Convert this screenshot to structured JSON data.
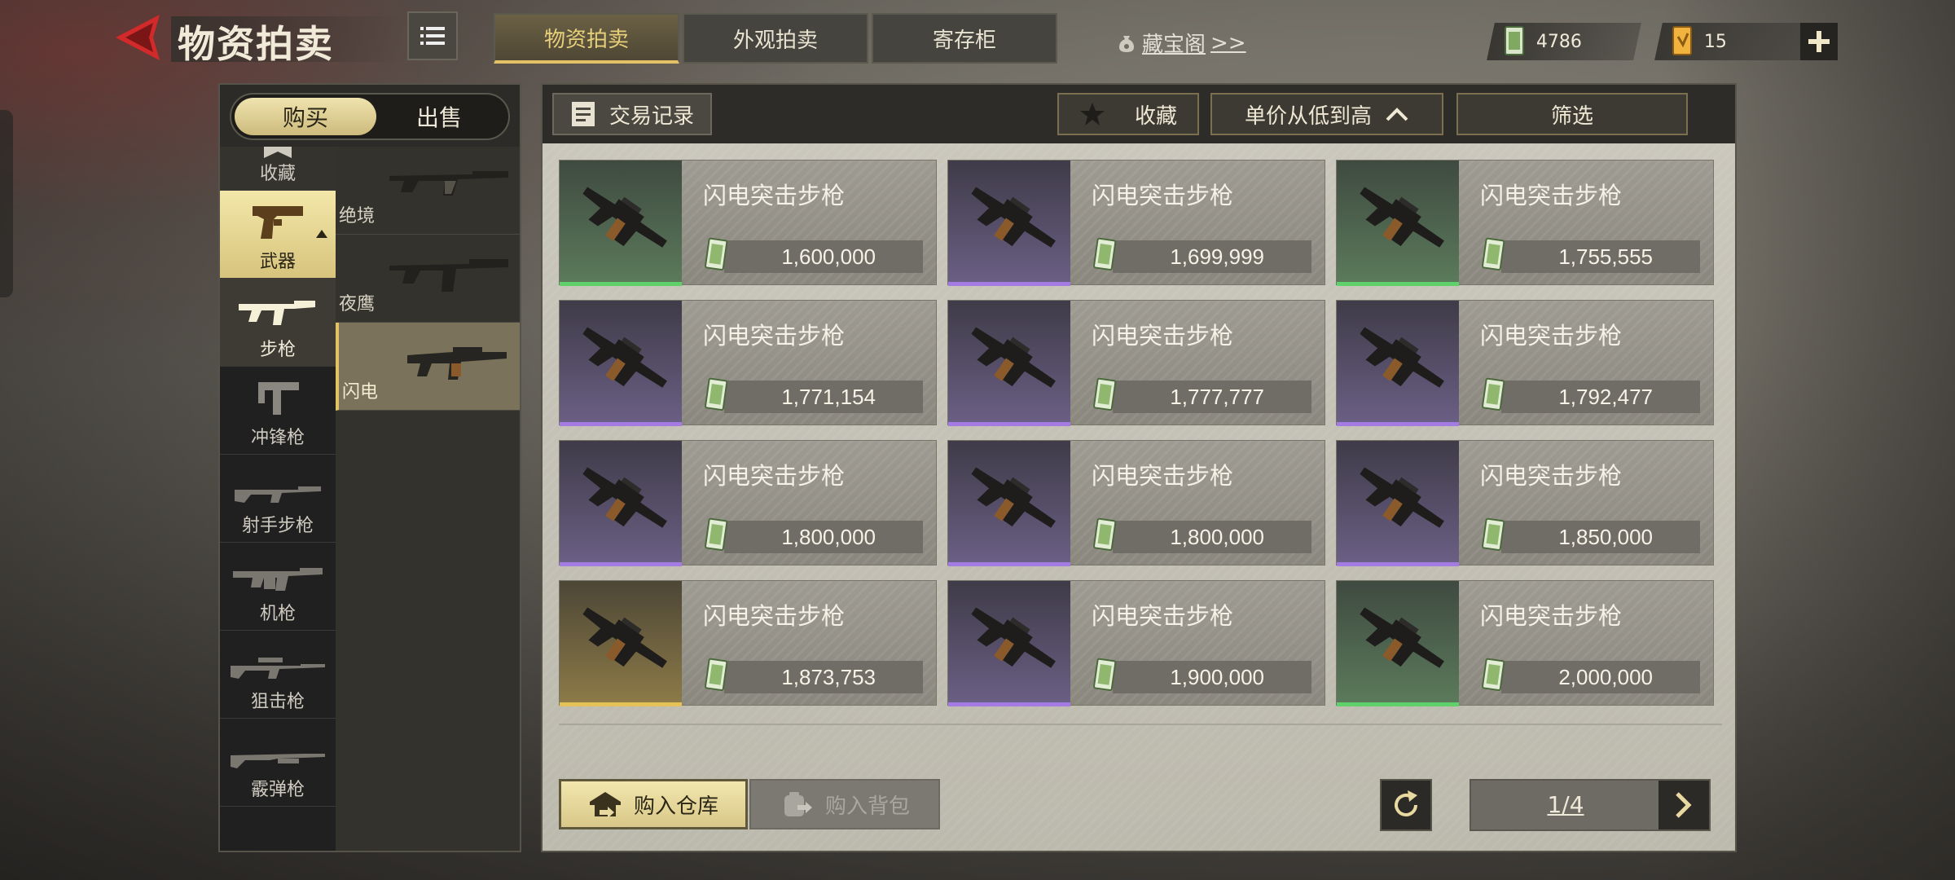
{
  "header": {
    "title": "物资拍卖",
    "tabs": [
      {
        "label": "物资拍卖",
        "active": true
      },
      {
        "label": "外观拍卖",
        "active": false
      },
      {
        "label": "寄存柜",
        "active": false
      }
    ],
    "vault_link": "藏宝阁",
    "vault_link_suffix": ">>",
    "currency1": "4786",
    "currency2": "15"
  },
  "sidebar": {
    "buy_label": "购买",
    "sell_label": "出售",
    "categories": [
      {
        "label": "收藏",
        "icon": "bookmark-icon"
      },
      {
        "label": "武器",
        "icon": "pistol-icon",
        "active": true
      },
      {
        "label": "步枪",
        "icon": "rifle-icon",
        "selected": true
      },
      {
        "label": "冲锋枪",
        "icon": "smg-icon"
      },
      {
        "label": "射手步枪",
        "icon": "dmr-icon"
      },
      {
        "label": "机枪",
        "icon": "machine-gun-icon"
      },
      {
        "label": "狙击枪",
        "icon": "sniper-icon"
      },
      {
        "label": "霰弹枪",
        "icon": "shotgun-icon"
      },
      {
        "label": "",
        "icon": "revolver-icon"
      }
    ],
    "subitems": [
      {
        "label": "绝境"
      },
      {
        "label": "夜鹰"
      },
      {
        "label": "闪电",
        "active": true
      }
    ]
  },
  "toolbar": {
    "trade_record": "交易记录",
    "favorite": "收藏",
    "sort": "单价从低到高",
    "filter": "筛选"
  },
  "listings": [
    {
      "name": "闪电突击步枪",
      "price": "1,600,000",
      "rarity": "green"
    },
    {
      "name": "闪电突击步枪",
      "price": "1,699,999",
      "rarity": "purple"
    },
    {
      "name": "闪电突击步枪",
      "price": "1,755,555",
      "rarity": "green"
    },
    {
      "name": "闪电突击步枪",
      "price": "1,771,154",
      "rarity": "purple"
    },
    {
      "name": "闪电突击步枪",
      "price": "1,777,777",
      "rarity": "purple"
    },
    {
      "name": "闪电突击步枪",
      "price": "1,792,477",
      "rarity": "purple"
    },
    {
      "name": "闪电突击步枪",
      "price": "1,800,000",
      "rarity": "purple"
    },
    {
      "name": "闪电突击步枪",
      "price": "1,800,000",
      "rarity": "purple"
    },
    {
      "name": "闪电突击步枪",
      "price": "1,850,000",
      "rarity": "purple"
    },
    {
      "name": "闪电突击步枪",
      "price": "1,873,753",
      "rarity": "gold"
    },
    {
      "name": "闪电突击步枪",
      "price": "1,900,000",
      "rarity": "purple"
    },
    {
      "name": "闪电突击步枪",
      "price": "2,000,000",
      "rarity": "green"
    }
  ],
  "footer": {
    "buy_warehouse": "购入仓库",
    "buy_backpack": "购入背包",
    "page": "1/4"
  },
  "colors": {
    "accent_gold": "#e3c266",
    "rarity_green": "#5ed16a",
    "rarity_purple": "#a47be3",
    "rarity_gold": "#e5c257",
    "back_red": "#d22a2a"
  }
}
